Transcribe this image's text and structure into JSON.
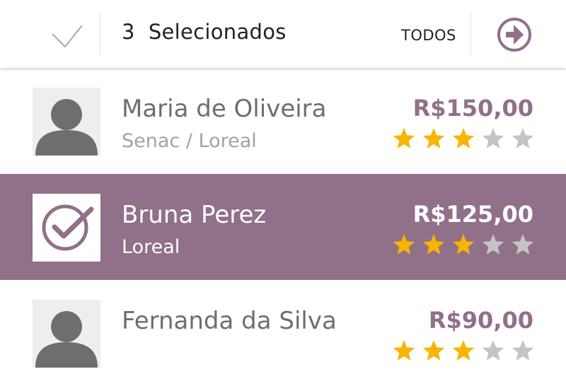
{
  "header": {
    "count": "3",
    "label": "Selecionados",
    "select_all_label": "TODOS",
    "check_icon": "checkmark-icon",
    "next_icon": "arrow-right-circle-icon"
  },
  "colors": {
    "accent": "#917089",
    "star_on": "#f7b500",
    "star_off": "#c4c4c4",
    "avatar_bg": "#eeeeee",
    "avatar_fg": "#6e6e6e"
  },
  "items": [
    {
      "name": "Maria de Oliveira",
      "subtitle": "Senac / Loreal",
      "price": "R$150,00",
      "rating": 3,
      "max_rating": 5,
      "selected": false
    },
    {
      "name": "Bruna Perez",
      "subtitle": "Loreal",
      "price": "R$125,00",
      "rating": 3,
      "max_rating": 5,
      "selected": true
    },
    {
      "name": "Fernanda da Silva",
      "subtitle": "",
      "price": "R$90,00",
      "rating": 3,
      "max_rating": 5,
      "selected": false
    }
  ]
}
